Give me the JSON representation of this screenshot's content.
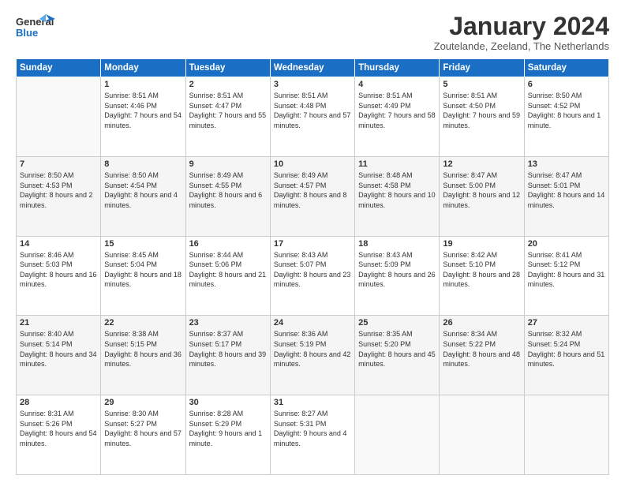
{
  "header": {
    "logo_general": "General",
    "logo_blue": "Blue",
    "title": "January 2024",
    "location": "Zoutelande, Zeeland, The Netherlands"
  },
  "days_of_week": [
    "Sunday",
    "Monday",
    "Tuesday",
    "Wednesday",
    "Thursday",
    "Friday",
    "Saturday"
  ],
  "weeks": [
    [
      {
        "day": "",
        "sunrise": "",
        "sunset": "",
        "daylight": ""
      },
      {
        "day": "1",
        "sunrise": "Sunrise: 8:51 AM",
        "sunset": "Sunset: 4:46 PM",
        "daylight": "Daylight: 7 hours and 54 minutes."
      },
      {
        "day": "2",
        "sunrise": "Sunrise: 8:51 AM",
        "sunset": "Sunset: 4:47 PM",
        "daylight": "Daylight: 7 hours and 55 minutes."
      },
      {
        "day": "3",
        "sunrise": "Sunrise: 8:51 AM",
        "sunset": "Sunset: 4:48 PM",
        "daylight": "Daylight: 7 hours and 57 minutes."
      },
      {
        "day": "4",
        "sunrise": "Sunrise: 8:51 AM",
        "sunset": "Sunset: 4:49 PM",
        "daylight": "Daylight: 7 hours and 58 minutes."
      },
      {
        "day": "5",
        "sunrise": "Sunrise: 8:51 AM",
        "sunset": "Sunset: 4:50 PM",
        "daylight": "Daylight: 7 hours and 59 minutes."
      },
      {
        "day": "6",
        "sunrise": "Sunrise: 8:50 AM",
        "sunset": "Sunset: 4:52 PM",
        "daylight": "Daylight: 8 hours and 1 minute."
      }
    ],
    [
      {
        "day": "7",
        "sunrise": "Sunrise: 8:50 AM",
        "sunset": "Sunset: 4:53 PM",
        "daylight": "Daylight: 8 hours and 2 minutes."
      },
      {
        "day": "8",
        "sunrise": "Sunrise: 8:50 AM",
        "sunset": "Sunset: 4:54 PM",
        "daylight": "Daylight: 8 hours and 4 minutes."
      },
      {
        "day": "9",
        "sunrise": "Sunrise: 8:49 AM",
        "sunset": "Sunset: 4:55 PM",
        "daylight": "Daylight: 8 hours and 6 minutes."
      },
      {
        "day": "10",
        "sunrise": "Sunrise: 8:49 AM",
        "sunset": "Sunset: 4:57 PM",
        "daylight": "Daylight: 8 hours and 8 minutes."
      },
      {
        "day": "11",
        "sunrise": "Sunrise: 8:48 AM",
        "sunset": "Sunset: 4:58 PM",
        "daylight": "Daylight: 8 hours and 10 minutes."
      },
      {
        "day": "12",
        "sunrise": "Sunrise: 8:47 AM",
        "sunset": "Sunset: 5:00 PM",
        "daylight": "Daylight: 8 hours and 12 minutes."
      },
      {
        "day": "13",
        "sunrise": "Sunrise: 8:47 AM",
        "sunset": "Sunset: 5:01 PM",
        "daylight": "Daylight: 8 hours and 14 minutes."
      }
    ],
    [
      {
        "day": "14",
        "sunrise": "Sunrise: 8:46 AM",
        "sunset": "Sunset: 5:03 PM",
        "daylight": "Daylight: 8 hours and 16 minutes."
      },
      {
        "day": "15",
        "sunrise": "Sunrise: 8:45 AM",
        "sunset": "Sunset: 5:04 PM",
        "daylight": "Daylight: 8 hours and 18 minutes."
      },
      {
        "day": "16",
        "sunrise": "Sunrise: 8:44 AM",
        "sunset": "Sunset: 5:06 PM",
        "daylight": "Daylight: 8 hours and 21 minutes."
      },
      {
        "day": "17",
        "sunrise": "Sunrise: 8:43 AM",
        "sunset": "Sunset: 5:07 PM",
        "daylight": "Daylight: 8 hours and 23 minutes."
      },
      {
        "day": "18",
        "sunrise": "Sunrise: 8:43 AM",
        "sunset": "Sunset: 5:09 PM",
        "daylight": "Daylight: 8 hours and 26 minutes."
      },
      {
        "day": "19",
        "sunrise": "Sunrise: 8:42 AM",
        "sunset": "Sunset: 5:10 PM",
        "daylight": "Daylight: 8 hours and 28 minutes."
      },
      {
        "day": "20",
        "sunrise": "Sunrise: 8:41 AM",
        "sunset": "Sunset: 5:12 PM",
        "daylight": "Daylight: 8 hours and 31 minutes."
      }
    ],
    [
      {
        "day": "21",
        "sunrise": "Sunrise: 8:40 AM",
        "sunset": "Sunset: 5:14 PM",
        "daylight": "Daylight: 8 hours and 34 minutes."
      },
      {
        "day": "22",
        "sunrise": "Sunrise: 8:38 AM",
        "sunset": "Sunset: 5:15 PM",
        "daylight": "Daylight: 8 hours and 36 minutes."
      },
      {
        "day": "23",
        "sunrise": "Sunrise: 8:37 AM",
        "sunset": "Sunset: 5:17 PM",
        "daylight": "Daylight: 8 hours and 39 minutes."
      },
      {
        "day": "24",
        "sunrise": "Sunrise: 8:36 AM",
        "sunset": "Sunset: 5:19 PM",
        "daylight": "Daylight: 8 hours and 42 minutes."
      },
      {
        "day": "25",
        "sunrise": "Sunrise: 8:35 AM",
        "sunset": "Sunset: 5:20 PM",
        "daylight": "Daylight: 8 hours and 45 minutes."
      },
      {
        "day": "26",
        "sunrise": "Sunrise: 8:34 AM",
        "sunset": "Sunset: 5:22 PM",
        "daylight": "Daylight: 8 hours and 48 minutes."
      },
      {
        "day": "27",
        "sunrise": "Sunrise: 8:32 AM",
        "sunset": "Sunset: 5:24 PM",
        "daylight": "Daylight: 8 hours and 51 minutes."
      }
    ],
    [
      {
        "day": "28",
        "sunrise": "Sunrise: 8:31 AM",
        "sunset": "Sunset: 5:26 PM",
        "daylight": "Daylight: 8 hours and 54 minutes."
      },
      {
        "day": "29",
        "sunrise": "Sunrise: 8:30 AM",
        "sunset": "Sunset: 5:27 PM",
        "daylight": "Daylight: 8 hours and 57 minutes."
      },
      {
        "day": "30",
        "sunrise": "Sunrise: 8:28 AM",
        "sunset": "Sunset: 5:29 PM",
        "daylight": "Daylight: 9 hours and 1 minute."
      },
      {
        "day": "31",
        "sunrise": "Sunrise: 8:27 AM",
        "sunset": "Sunset: 5:31 PM",
        "daylight": "Daylight: 9 hours and 4 minutes."
      },
      {
        "day": "",
        "sunrise": "",
        "sunset": "",
        "daylight": ""
      },
      {
        "day": "",
        "sunrise": "",
        "sunset": "",
        "daylight": ""
      },
      {
        "day": "",
        "sunrise": "",
        "sunset": "",
        "daylight": ""
      }
    ]
  ]
}
